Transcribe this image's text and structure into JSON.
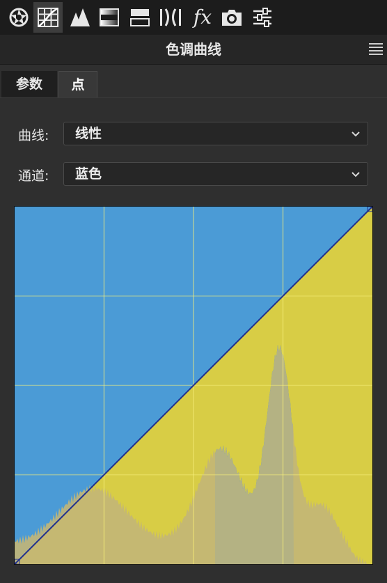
{
  "toolbar": {
    "tools": [
      {
        "icon": "aperture-icon"
      },
      {
        "icon": "tone-curve-icon",
        "active": true
      },
      {
        "icon": "detail-icon"
      },
      {
        "icon": "hsl-icon"
      },
      {
        "icon": "split-toning-icon"
      },
      {
        "icon": "lens-corrections-icon"
      },
      {
        "icon": "effects-icon",
        "label": "fx"
      },
      {
        "icon": "camera-calibration-icon"
      },
      {
        "icon": "presets-sliders-icon"
      }
    ]
  },
  "panel": {
    "title": "色调曲线"
  },
  "tabs": [
    {
      "label": "参数"
    },
    {
      "label": "点",
      "active": true
    }
  ],
  "curve_type": {
    "label": "曲线:",
    "value": "线性"
  },
  "channel": {
    "label": "通道:",
    "value": "蓝色"
  },
  "curve_editor": {
    "channel_color_above": "#4b9bd6",
    "channel_color_below": "#d8cd45",
    "histogram_color": "#c3b677",
    "histogram_overflow_color": "#2d8df0",
    "grid_color": "#f5ee7a",
    "curve_color": "#1f2f8e",
    "grid_divisions": 4,
    "curve_points": [
      [
        0,
        0
      ],
      [
        255,
        255
      ]
    ]
  }
}
